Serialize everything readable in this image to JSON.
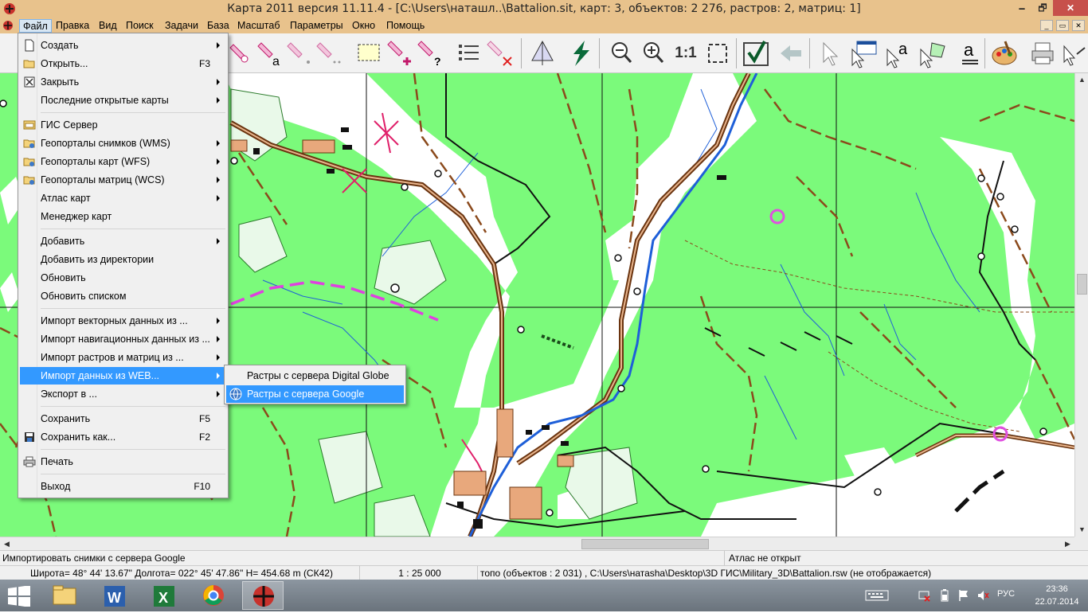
{
  "window": {
    "title": "Карта 2011 версия 11.11.4 - [C:\\Users\\наташл..\\Battalion.sit, карт: 3, объектов: 2 276, растров: 2, матриц: 1]",
    "min_label": "🗕",
    "max_label": "🗗",
    "close_label": "✕"
  },
  "menubar": {
    "items": [
      "Файл",
      "Правка",
      "Вид",
      "Поиск",
      "Задачи",
      "База",
      "Масштаб",
      "Параметры",
      "Окно",
      "Помощь"
    ]
  },
  "file_menu": {
    "items": [
      {
        "label": "Создать",
        "shortcut": "",
        "arrow": true,
        "icon": "new-document-icon"
      },
      {
        "label": "Открыть...",
        "shortcut": "F3",
        "arrow": false,
        "icon": "open-folder-icon"
      },
      {
        "label": "Закрыть",
        "shortcut": "",
        "arrow": true,
        "icon": "close-box-icon"
      },
      {
        "label": "Последние открытые карты",
        "shortcut": "",
        "arrow": true,
        "icon": ""
      },
      {
        "label": "ГИС Сервер",
        "shortcut": "",
        "arrow": false,
        "icon": "gis-server-icon"
      },
      {
        "label": "Геопорталы снимков (WMS)",
        "shortcut": "",
        "arrow": true,
        "icon": "folder-icon"
      },
      {
        "label": "Геопорталы карт (WFS)",
        "shortcut": "",
        "arrow": true,
        "icon": "folder-icon"
      },
      {
        "label": "Геопорталы матриц (WCS)",
        "shortcut": "",
        "arrow": true,
        "icon": "folder-icon"
      },
      {
        "label": "Атлас карт",
        "shortcut": "",
        "arrow": true,
        "icon": ""
      },
      {
        "label": "Менеджер карт",
        "shortcut": "",
        "arrow": false,
        "icon": ""
      },
      {
        "label": "Добавить",
        "shortcut": "",
        "arrow": true,
        "icon": ""
      },
      {
        "label": "Добавить из директории",
        "shortcut": "",
        "arrow": false,
        "icon": ""
      },
      {
        "label": "Обновить",
        "shortcut": "",
        "arrow": false,
        "icon": ""
      },
      {
        "label": "Обновить списком",
        "shortcut": "",
        "arrow": false,
        "icon": ""
      },
      {
        "label": "Импорт векторных данных из ...",
        "shortcut": "",
        "arrow": true,
        "icon": ""
      },
      {
        "label": "Импорт навигационных данных из ...",
        "shortcut": "",
        "arrow": true,
        "icon": ""
      },
      {
        "label": "Импорт растров и матриц из ...",
        "shortcut": "",
        "arrow": true,
        "icon": ""
      },
      {
        "label": "Импорт данных из WEB...",
        "shortcut": "",
        "arrow": true,
        "icon": ""
      },
      {
        "label": "Экспорт в ...",
        "shortcut": "",
        "arrow": true,
        "icon": ""
      },
      {
        "label": "Сохранить",
        "shortcut": "F5",
        "arrow": false,
        "icon": ""
      },
      {
        "label": "Сохранить как...",
        "shortcut": "F2",
        "arrow": false,
        "icon": "save-icon"
      },
      {
        "label": "Печать",
        "shortcut": "",
        "arrow": false,
        "icon": "printer-icon"
      },
      {
        "label": "Выход",
        "shortcut": "F10",
        "arrow": false,
        "icon": ""
      }
    ],
    "highlighted": "Импорт данных из WEB..."
  },
  "web_submenu": {
    "items": [
      {
        "label": "Растры с сервера Digital Globe"
      },
      {
        "label": "Растры с сервера Google"
      }
    ],
    "highlighted": "Растры с сервера Google"
  },
  "toolbar": {
    "buttons": [
      "select-object-icon",
      "select-text-icon",
      "select-partial-icon",
      "select-multi-icon",
      "select-frame-icon",
      "add-select-icon",
      "query-select-icon",
      "list-icon",
      "clear-select-icon",
      "3d-view-icon",
      "lightning-icon",
      "zoom-out-icon",
      "zoom-in-icon",
      "scale-1-1-icon",
      "fit-frame-icon",
      "check-icon",
      "back-arrow-icon",
      "pointer-icon",
      "table-cursor-icon",
      "text-cursor-icon",
      "polygon-cursor-icon",
      "text-edit-icon",
      "palette-icon",
      "printer-icon",
      "forward-arrow-icon"
    ],
    "scale_label": "1:1"
  },
  "status": {
    "hint": "Импортировать снимки с сервера Google",
    "atlas": "Атлас не открыт",
    "coords": "Широта= 48° 44' 13.67\" Долгота= 022° 45' 47.86\" H= 454.68 m  (СК42)",
    "scale": "1 : 25 000",
    "layer": "топо   (объектов : 2 031) , C:\\Users\\натаsha\\Desktop\\3D ГИС\\Military_3D\\Battalion.rsw (не отображается)"
  },
  "taskbar": {
    "apps": [
      "explorer-icon",
      "word-icon",
      "excel-icon",
      "chrome-icon",
      "map2011-icon"
    ],
    "lang": "РУС",
    "time": "23:36",
    "date": "22.07.2014"
  },
  "colors": {
    "titlebar": "#e8c28c",
    "map_green": "#7bfa7b",
    "highlight": "#3399ff",
    "road_brown": "#8b4a1c",
    "river_blue": "#1e5fd8"
  }
}
